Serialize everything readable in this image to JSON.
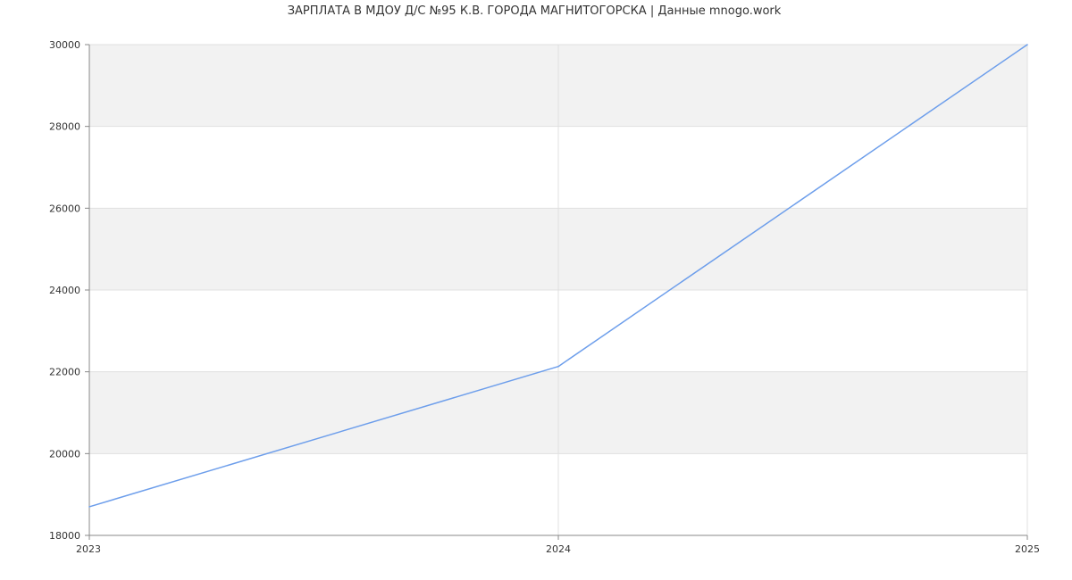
{
  "chart_data": {
    "type": "line",
    "title": "ЗАРПЛАТА В МДОУ Д/С №95 К.В. ГОРОДА МАГНИТОГОРСКА | Данные mnogo.work",
    "xlabel": "",
    "ylabel": "",
    "x": [
      2023,
      2024,
      2025
    ],
    "x_tick_labels": [
      "2023",
      "2024",
      "2025"
    ],
    "y_ticks": [
      18000,
      20000,
      22000,
      24000,
      26000,
      28000,
      30000
    ],
    "y_tick_labels": [
      "18000",
      "20000",
      "22000",
      "24000",
      "26000",
      "28000",
      "30000"
    ],
    "xlim": [
      2023,
      2025
    ],
    "ylim": [
      18000,
      30000
    ],
    "grid": true,
    "series": [
      {
        "values": [
          18700,
          22130,
          30000
        ],
        "color": "#6d9eeb"
      }
    ],
    "band_color": "#f2f2f2",
    "grid_color": "#e0e0e0",
    "axis_color": "#888888"
  }
}
